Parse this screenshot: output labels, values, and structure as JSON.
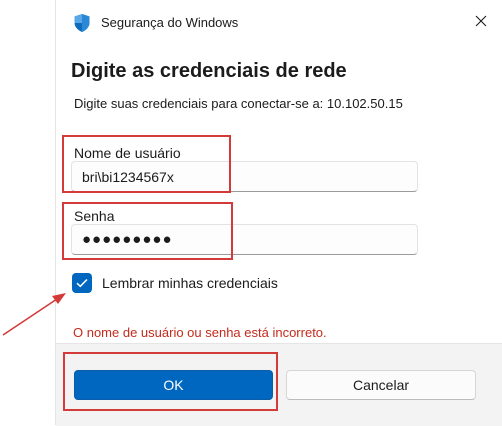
{
  "window": {
    "title": "Segurança do Windows",
    "app_icon": "shield-icon",
    "close_icon": "close-icon"
  },
  "heading": "Digite as credenciais de rede",
  "subtext": "Digite suas credenciais para conectar-se a: 10.102.50.15",
  "username": {
    "label": "Nome de usuário",
    "value": "bri\\bi1234567x"
  },
  "password": {
    "label": "Senha",
    "value_masked": "●●●●●●●●●"
  },
  "remember": {
    "label": "Lembrar minhas credenciais",
    "checked": true
  },
  "error_message": "O nome de usuário ou senha está incorreto.",
  "buttons": {
    "ok": "OK",
    "cancel": "Cancelar"
  },
  "colors": {
    "accent": "#0067c0",
    "error": "#c42b1c",
    "annotation": "#d33a3a"
  }
}
